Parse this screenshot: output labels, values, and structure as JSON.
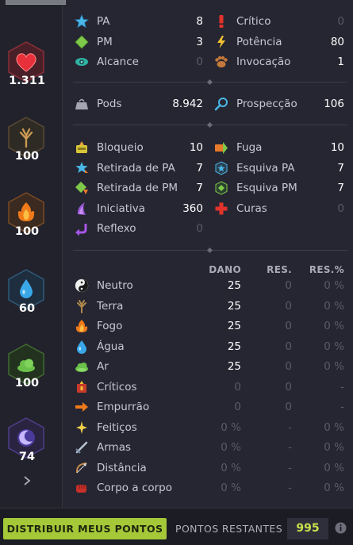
{
  "colors": {
    "accent": "#a4c838",
    "value_on": "#ffffff",
    "value_off": "#5b5b68"
  },
  "characteristics": [
    {
      "name": "vitality",
      "icon": "heart-icon",
      "value": "1.311"
    },
    {
      "name": "wisdom",
      "icon": "wisdom-tree-icon",
      "value": "100"
    },
    {
      "name": "strength",
      "icon": "earth-flame-icon",
      "value": "100"
    },
    {
      "name": "intelligence",
      "icon": "water-drop-icon",
      "value": "60"
    },
    {
      "name": "agility",
      "icon": "cloud-icon",
      "value": "100"
    },
    {
      "name": "chance",
      "icon": "moon-icon",
      "value": "74"
    }
  ],
  "stats_basic": [
    {
      "icon": "star-icon",
      "label": "PA",
      "value": "8"
    },
    {
      "icon": "exclamation-icon",
      "label": "Crítico",
      "value": "0"
    },
    {
      "icon": "diamond-icon",
      "label": "PM",
      "value": "3"
    },
    {
      "icon": "lightning-icon",
      "label": "Potência",
      "value": "80"
    },
    {
      "icon": "eye-icon",
      "label": "Alcance",
      "value": "0"
    },
    {
      "icon": "paw-icon",
      "label": "Invocação",
      "value": "1"
    }
  ],
  "stats_pods": [
    {
      "icon": "weight-icon",
      "label": "Pods",
      "value": "8.942"
    },
    {
      "icon": "magnifier-icon",
      "label": "Prospecção",
      "value": "106"
    }
  ],
  "stats_tackle": [
    {
      "icon": "block-icon",
      "label": "Bloqueio",
      "value": "10"
    },
    {
      "icon": "flee-icon",
      "label": "Fuga",
      "value": "10"
    },
    {
      "icon": "ap-reduction-icon",
      "label": "Retirada de PA",
      "value": "7"
    },
    {
      "icon": "ap-dodge-icon",
      "label": "Esquiva PA",
      "value": "7"
    },
    {
      "icon": "mp-reduction-icon",
      "label": "Retirada de PM",
      "value": "7"
    },
    {
      "icon": "mp-dodge-icon",
      "label": "Esquiva PM",
      "value": "7"
    },
    {
      "icon": "initiative-icon",
      "label": "Iniciativa",
      "value": "360"
    },
    {
      "icon": "heal-cross-icon",
      "label": "Curas",
      "value": "0"
    },
    {
      "icon": "reflect-icon",
      "label": "Reflexo",
      "value": "0"
    }
  ],
  "damage_headers": {
    "dano": "DANO",
    "res": "RES.",
    "res_pct": "RES.%"
  },
  "damage_rows": [
    {
      "icon": "yin-yang-icon",
      "label": "Neutro",
      "dano": "25",
      "res": "0",
      "res_pct": "0 %"
    },
    {
      "icon": "earth-tree-icon",
      "label": "Terra",
      "dano": "25",
      "res": "0",
      "res_pct": "0 %"
    },
    {
      "icon": "fire-icon",
      "label": "Fogo",
      "dano": "25",
      "res": "0",
      "res_pct": "0 %"
    },
    {
      "icon": "water-icon",
      "label": "Água",
      "dano": "25",
      "res": "0",
      "res_pct": "0 %"
    },
    {
      "icon": "air-icon",
      "label": "Ar",
      "dano": "25",
      "res": "0",
      "res_pct": "0 %"
    },
    {
      "icon": "critical-hit-icon",
      "label": "Críticos",
      "dano": "0",
      "res": "0",
      "res_pct": "-"
    },
    {
      "icon": "push-arrow-icon",
      "label": "Empurrão",
      "dano": "0",
      "res": "0",
      "res_pct": "-"
    },
    {
      "icon": "spell-spark-icon",
      "label": "Feitiços",
      "dano": "0 %",
      "res": "-",
      "res_pct": "0 %"
    },
    {
      "icon": "sword-icon",
      "label": "Armas",
      "dano": "0 %",
      "res": "-",
      "res_pct": "0 %"
    },
    {
      "icon": "bow-icon",
      "label": "Distância",
      "dano": "0 %",
      "res": "-",
      "res_pct": "0 %"
    },
    {
      "icon": "fist-icon",
      "label": "Corpo a corpo",
      "dano": "0 %",
      "res": "-",
      "res_pct": "0 %"
    }
  ],
  "footer": {
    "distribute_button": "DISTRIBUIR MEUS PONTOS",
    "remaining_label": "PONTOS RESTANTES",
    "remaining_value": "995"
  }
}
